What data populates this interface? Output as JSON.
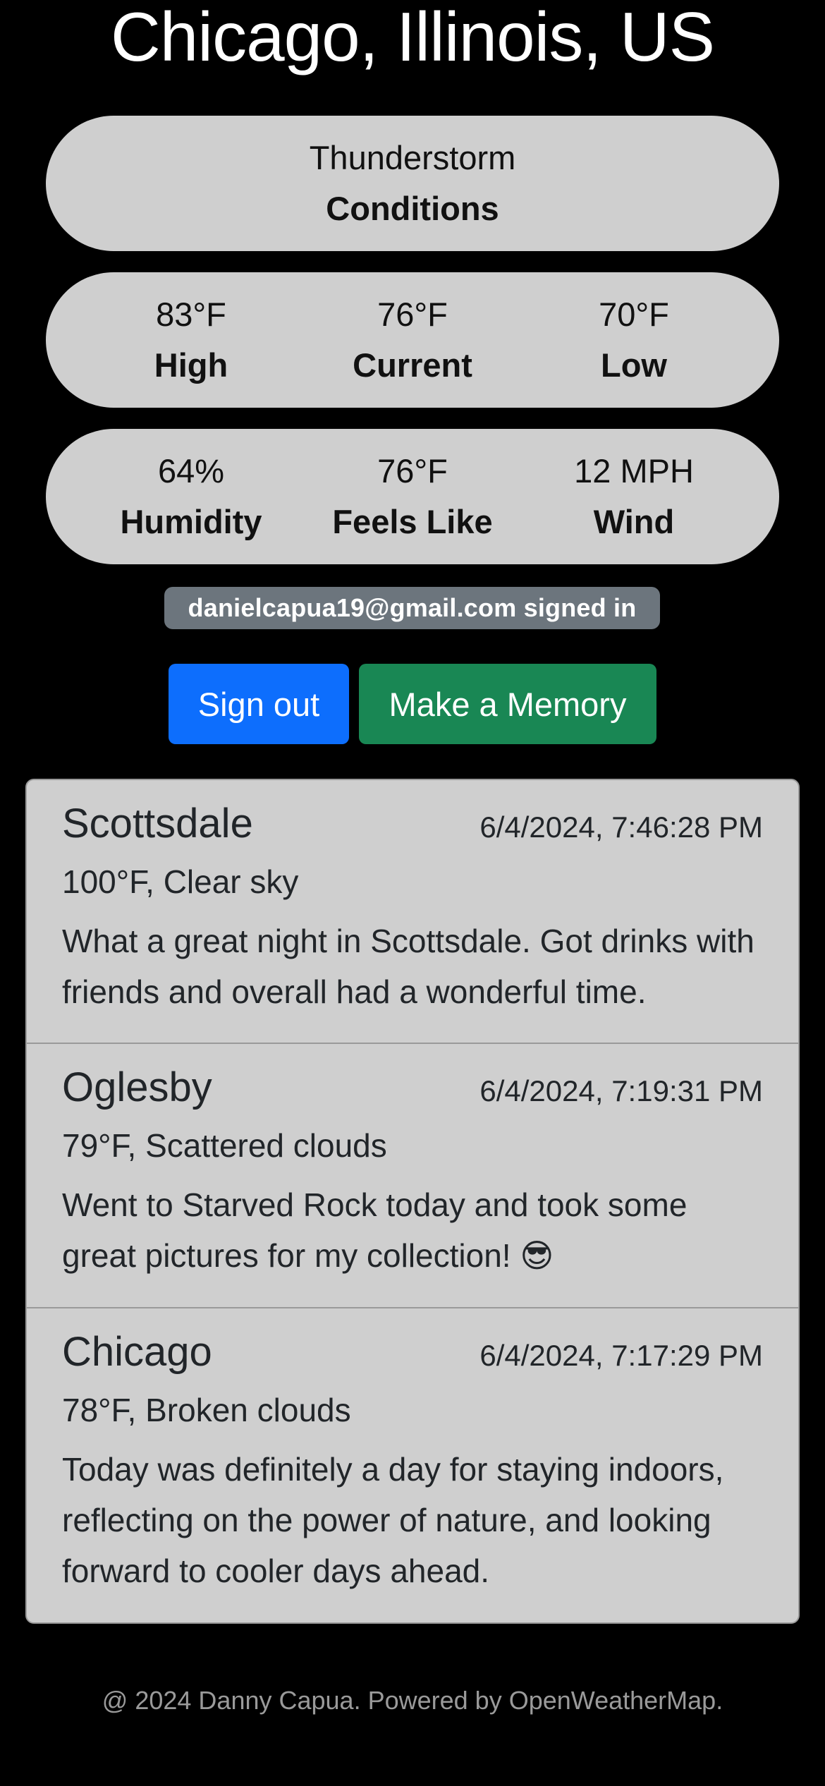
{
  "location": {
    "title": "Chicago, Illinois, US"
  },
  "conditions": {
    "value": "Thunderstorm",
    "label": "Conditions"
  },
  "temps": [
    {
      "value": "83°F",
      "label": "High"
    },
    {
      "value": "76°F",
      "label": "Current"
    },
    {
      "value": "70°F",
      "label": "Low"
    }
  ],
  "details": [
    {
      "value": "64%",
      "label": "Humidity"
    },
    {
      "value": "76°F",
      "label": "Feels Like"
    },
    {
      "value": "12 MPH",
      "label": "Wind"
    }
  ],
  "auth": {
    "status": "danielcapua19@gmail.com signed in"
  },
  "actions": {
    "signout_label": "Sign out",
    "memory_label": "Make a Memory"
  },
  "memories": [
    {
      "city": "Scottsdale",
      "timestamp": "6/4/2024, 7:46:28 PM",
      "weather": "100°F, Clear sky",
      "note": "What a great night in Scottsdale. Got drinks with friends and overall had a wonderful time."
    },
    {
      "city": "Oglesby",
      "timestamp": "6/4/2024, 7:19:31 PM",
      "weather": "79°F, Scattered clouds",
      "note": "Went to Starved Rock today and took some great pictures for my collection! 😎"
    },
    {
      "city": "Chicago",
      "timestamp": "6/4/2024, 7:17:29 PM",
      "weather": "78°F, Broken clouds",
      "note": "Today was definitely a day for staying indoors, reflecting on the power of nature, and looking forward to cooler days ahead."
    }
  ],
  "footer": {
    "text": "@ 2024 Danny Capua. Powered by OpenWeatherMap."
  }
}
